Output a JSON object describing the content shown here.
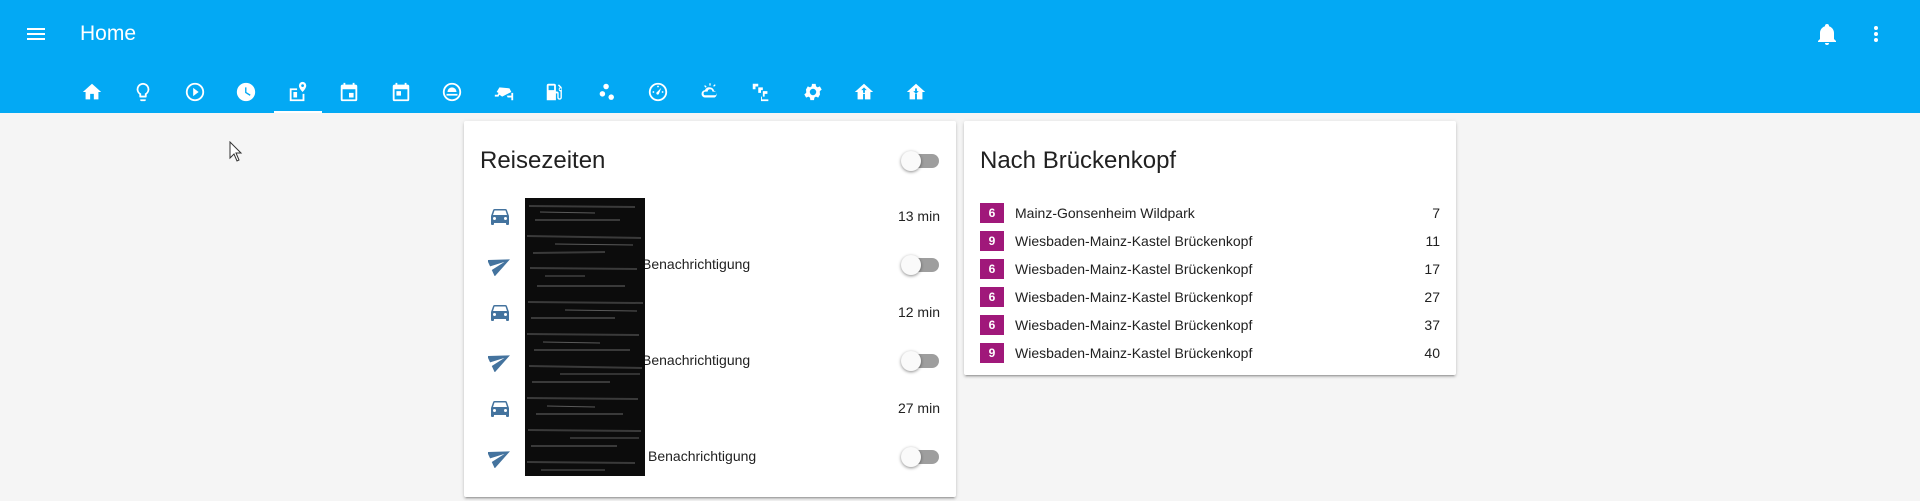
{
  "header": {
    "title": "Home",
    "tabs": [
      {
        "icon": "home-icon",
        "active": false
      },
      {
        "icon": "lightbulb-icon",
        "active": false
      },
      {
        "icon": "play-circle-icon",
        "active": false
      },
      {
        "icon": "clock-icon",
        "active": false
      },
      {
        "icon": "map-marker-distance-icon",
        "active": true
      },
      {
        "icon": "calendar-icon",
        "active": false
      },
      {
        "icon": "calendar-today-icon",
        "active": false
      },
      {
        "icon": "robot-vacuum-icon",
        "active": false
      },
      {
        "icon": "cctv-icon",
        "active": false
      },
      {
        "icon": "gas-station-icon",
        "active": false
      },
      {
        "icon": "scatter-plot-icon",
        "active": false
      },
      {
        "icon": "speedometer-icon",
        "active": false
      },
      {
        "icon": "weather-partly-cloudy-icon",
        "active": false
      },
      {
        "icon": "stairs-icon",
        "active": false
      },
      {
        "icon": "settings-icon",
        "active": false
      },
      {
        "icon": "home-export-icon",
        "active": false
      },
      {
        "icon": "home-import-icon",
        "active": false
      }
    ],
    "actions": [
      "bell-icon",
      "dots-vertical-icon"
    ]
  },
  "reisezeiten": {
    "title": "Reisezeiten",
    "toggle_on": false,
    "rows": [
      {
        "icon": "car-icon",
        "label": "",
        "value": "13 min"
      },
      {
        "icon": "send-icon",
        "label": "Benachrichtigung",
        "toggle_on": false
      },
      {
        "icon": "car-icon",
        "label": "",
        "value": "12 min"
      },
      {
        "icon": "send-icon",
        "label": "Benachrichtigung",
        "toggle_on": false
      },
      {
        "icon": "car-icon",
        "label": "",
        "value": "27 min"
      },
      {
        "icon": "send-icon",
        "label": "Benachrichtigung",
        "toggle_on": false
      }
    ]
  },
  "departures": {
    "title": "Nach Brückenkopf",
    "badge_color": "#a0187a",
    "rows": [
      {
        "line": "6",
        "stop": "Mainz-Gonsenheim Wildpark",
        "minutes": "7"
      },
      {
        "line": "9",
        "stop": "Wiesbaden-Mainz-Kastel Brückenkopf",
        "minutes": "11"
      },
      {
        "line": "6",
        "stop": "Wiesbaden-Mainz-Kastel Brückenkopf",
        "minutes": "17"
      },
      {
        "line": "6",
        "stop": "Wiesbaden-Mainz-Kastel Brückenkopf",
        "minutes": "27"
      },
      {
        "line": "6",
        "stop": "Wiesbaden-Mainz-Kastel Brückenkopf",
        "minutes": "37"
      },
      {
        "line": "9",
        "stop": "Wiesbaden-Mainz-Kastel Brückenkopf",
        "minutes": "40"
      }
    ]
  },
  "colors": {
    "accent": "#03a9f4",
    "icon_blue": "#44739e",
    "badge": "#a0187a"
  }
}
